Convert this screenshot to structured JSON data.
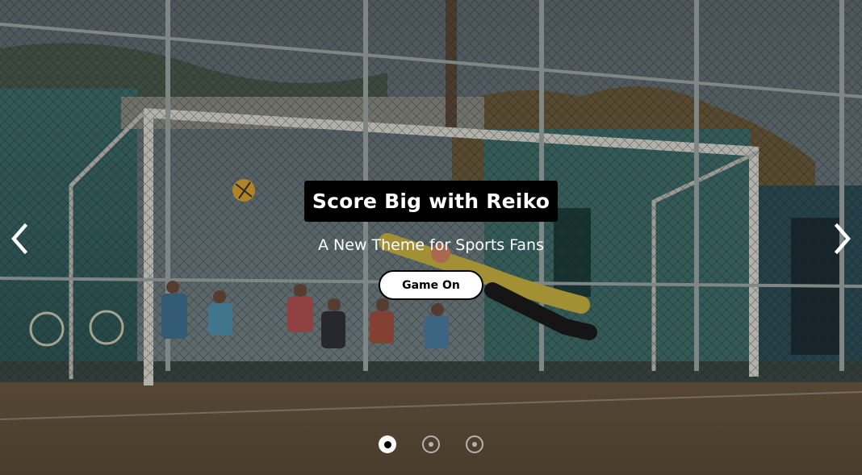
{
  "slide": {
    "title": "Score Big with Reiko",
    "subtitle": "A New Theme for Sports Fans",
    "button_label": "Game On"
  },
  "navigation": {
    "prev_icon": "chevron-left-icon",
    "next_icon": "chevron-right-icon"
  },
  "pagination": {
    "total": 3,
    "active_index": 0
  },
  "colors": {
    "title_bg": "#000000",
    "text": "#ffffff",
    "button_bg": "#ffffff",
    "button_text": "#000000"
  }
}
